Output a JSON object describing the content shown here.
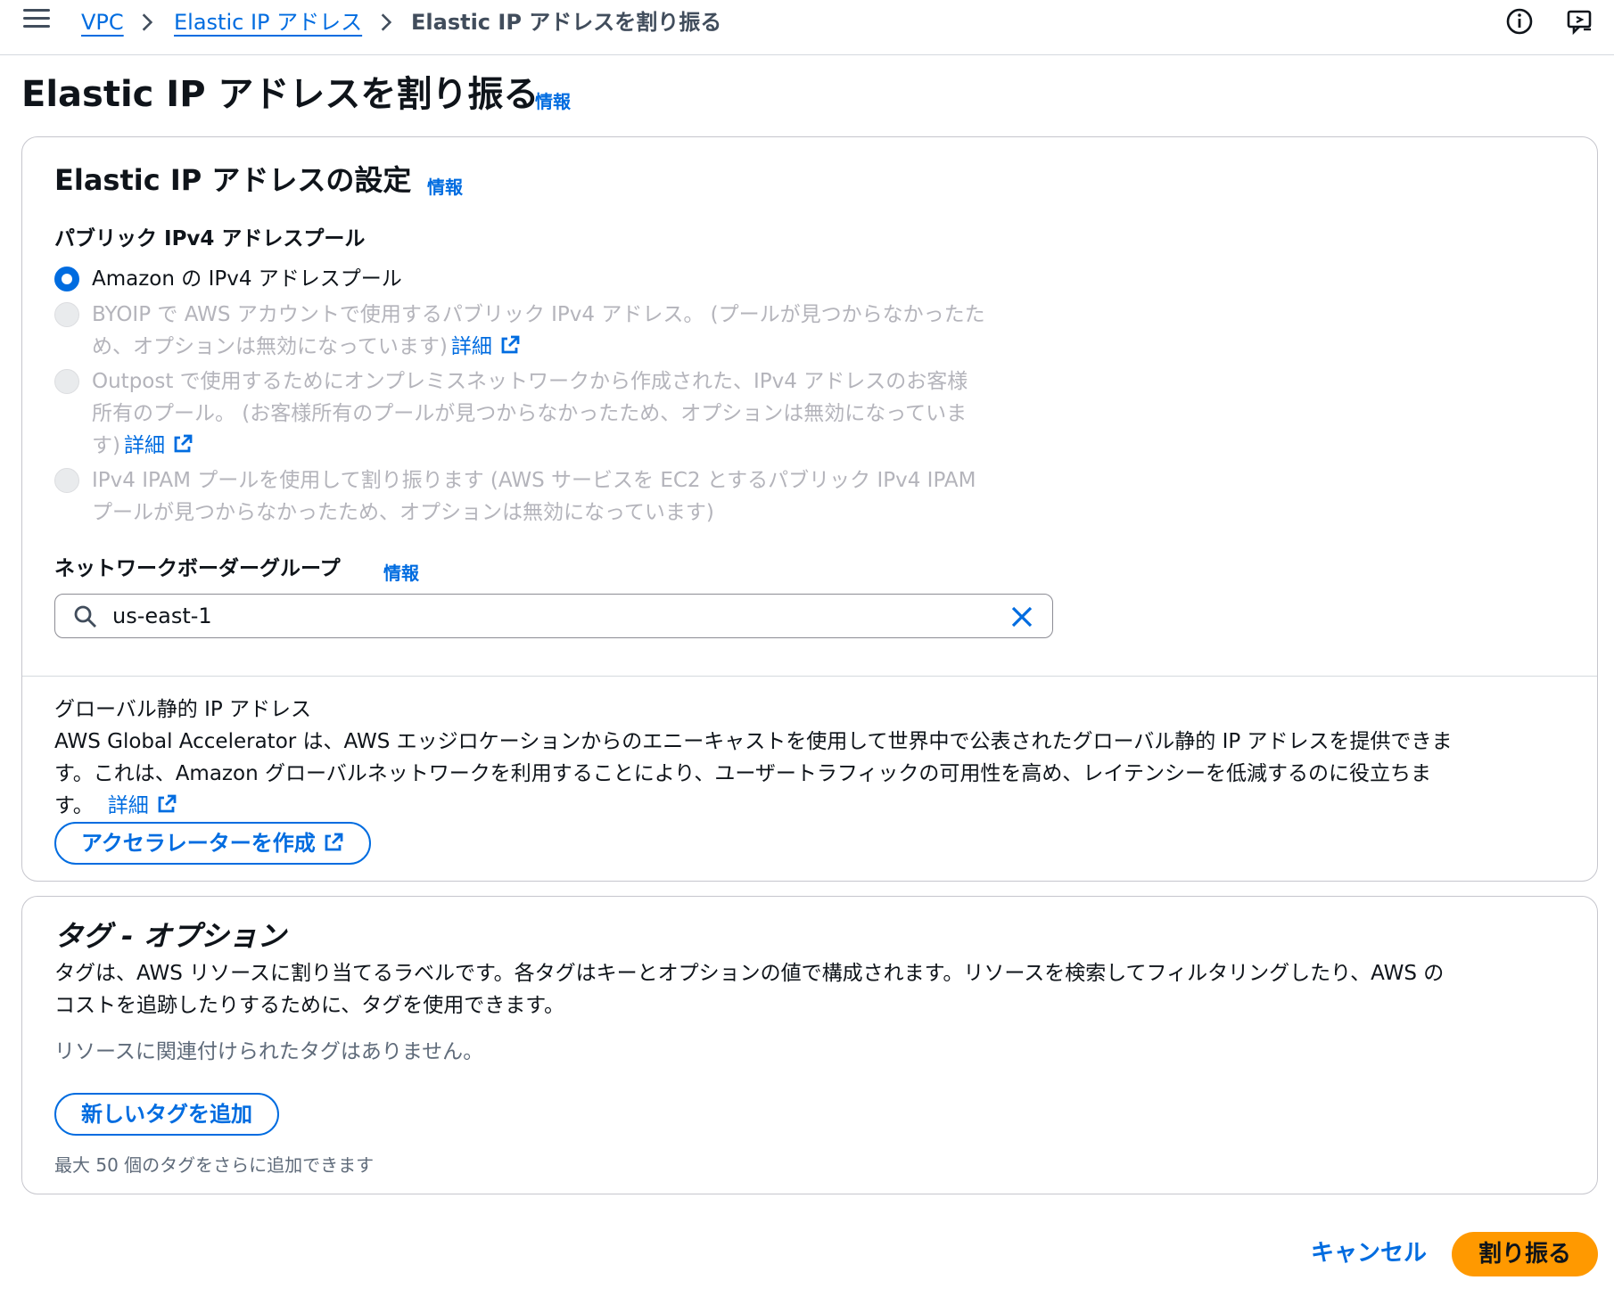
{
  "breadcrumb": {
    "items": [
      "VPC",
      "Elastic IP アドレス"
    ],
    "current": "Elastic IP アドレスを割り振る"
  },
  "page": {
    "title": "Elastic IP アドレスを割り振る",
    "info": "情報"
  },
  "settings": {
    "title": "Elastic IP アドレスの設定",
    "info": "情報",
    "pool_label": "パブリック IPv4 アドレスプール",
    "options": [
      {
        "lines": [
          "Amazon の IPv4 アドレスプール"
        ],
        "selected": true,
        "disabled": false
      },
      {
        "lines": [
          "BYOIP で AWS アカウントで使用するパブリック IPv4 アドレス。 (プールが見つからなかったた",
          "め、オプションは無効になっています)"
        ],
        "link": "詳細",
        "selected": false,
        "disabled": true
      },
      {
        "lines": [
          "Outpost で使用するためにオンプレミスネットワークから作成された、IPv4 アドレスのお客様",
          "所有のプール。 (お客様所有のプールが見つからなかったため、オプションは無効になっていま",
          "す)"
        ],
        "link": "詳細",
        "selected": false,
        "disabled": true
      },
      {
        "lines": [
          "IPv4 IPAM プールを使用して割り振ります (AWS サービスを EC2 とするパブリック IPv4 IPAM",
          "プールが見つからなかったため、オプションは無効になっています)"
        ],
        "selected": false,
        "disabled": true
      }
    ],
    "nbg_label": "ネットワークボーダーグループ",
    "nbg_info": "情報",
    "nbg_value": "us-east-1",
    "global_title": "グローバル静的 IP アドレス",
    "global_lines": [
      "AWS Global Accelerator は、AWS エッジロケーションからのエニーキャストを使用して世界中で公表されたグローバル静的 IP アドレスを提供できま",
      "す。これは、Amazon グローバルネットワークを利用することにより、ユーザートラフィックの可用性を高め、レイテンシーを低減するのに役立ちま",
      "す。"
    ],
    "global_link": "詳細",
    "create_accelerator": "アクセラレーターを作成"
  },
  "tags": {
    "title": "タグ - オプション",
    "desc_lines": [
      "タグは、AWS リソースに割り当てるラベルです。各タグはキーとオプションの値で構成されます。リソースを検索してフィルタリングしたり、AWS の",
      "コストを追跡したりするために、タグを使用できます。"
    ],
    "empty": "リソースに関連付けられたタグはありません。",
    "add_button": "新しいタグを追加",
    "limit": "最大 50 個のタグをさらに追加できます"
  },
  "actions": {
    "cancel": "キャンセル",
    "submit": "割り振る"
  },
  "colors": {
    "link": "#006ce0",
    "primary": "#ff9900",
    "disabled_text": "#b4b4bb"
  }
}
